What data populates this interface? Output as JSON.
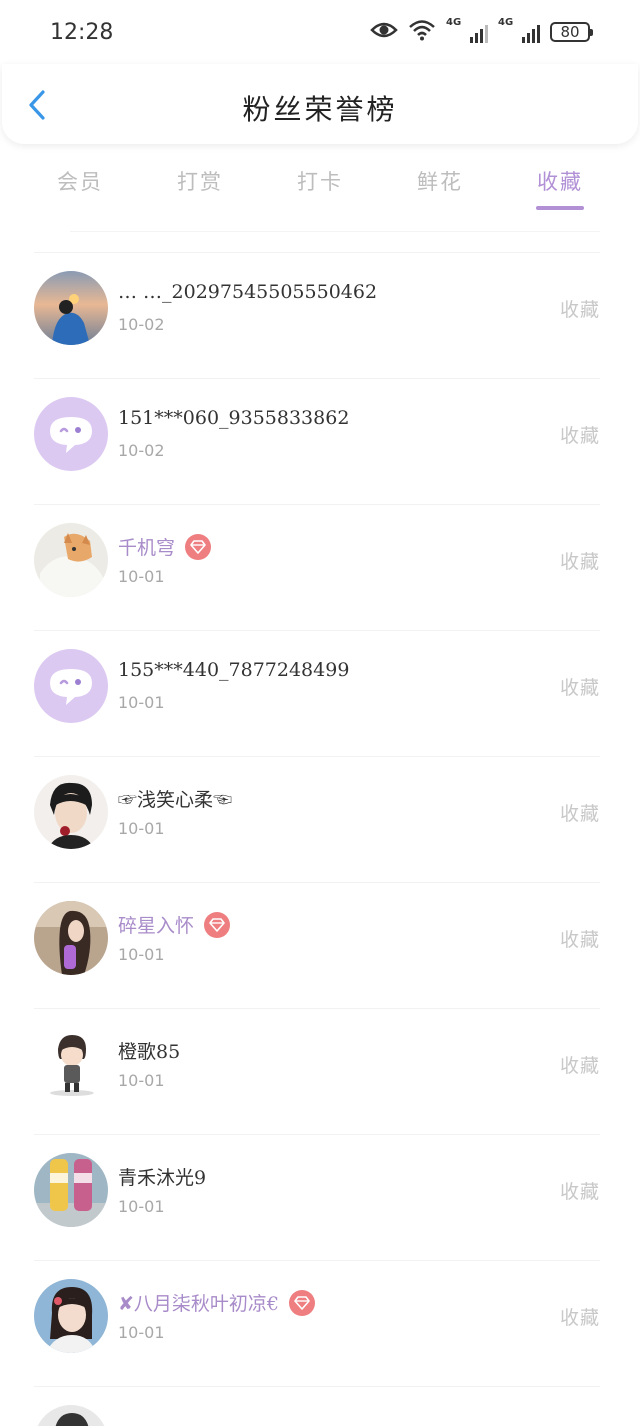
{
  "status_bar": {
    "time": "12:28",
    "net1": "4G",
    "net2": "4G",
    "battery": "80"
  },
  "header": {
    "title": "粉丝荣誉榜"
  },
  "tabs": [
    {
      "label": "会员",
      "active": false
    },
    {
      "label": "打赏",
      "active": false
    },
    {
      "label": "打卡",
      "active": false
    },
    {
      "label": "鲜花",
      "active": false
    },
    {
      "label": "收藏",
      "active": true
    }
  ],
  "colors": {
    "accent": "#b190d6",
    "badge": "#ee7e80",
    "muted": "#c8c8c8"
  },
  "fans": [
    {
      "name": "… …_20297545505550462",
      "date": "10-02",
      "action": "收藏",
      "vip": false,
      "avatar": "sunset-photo"
    },
    {
      "name": "151***060_9355833862",
      "date": "10-02",
      "action": "收藏",
      "vip": false,
      "avatar": "default-chat-avatar"
    },
    {
      "name": "千机穹",
      "date": "10-01",
      "action": "收藏",
      "vip": true,
      "avatar": "cat-photo"
    },
    {
      "name": "155***440_7877248499",
      "date": "10-01",
      "action": "收藏",
      "vip": false,
      "avatar": "default-chat-avatar"
    },
    {
      "name": "☞浅笑心柔☜",
      "date": "10-01",
      "action": "收藏",
      "vip": false,
      "avatar": "portrait-photo"
    },
    {
      "name": "碎星入怀",
      "date": "10-01",
      "action": "收藏",
      "vip": true,
      "avatar": "girl-photo"
    },
    {
      "name": "橙歌85",
      "date": "10-01",
      "action": "收藏",
      "vip": false,
      "avatar": "cartoon-boy"
    },
    {
      "name": "青禾沐光9",
      "date": "10-01",
      "action": "收藏",
      "vip": false,
      "avatar": "bottles-photo"
    },
    {
      "name": "✘八月柒秋叶初凉€",
      "date": "10-01",
      "action": "收藏",
      "vip": true,
      "avatar": "anime-girl"
    }
  ]
}
